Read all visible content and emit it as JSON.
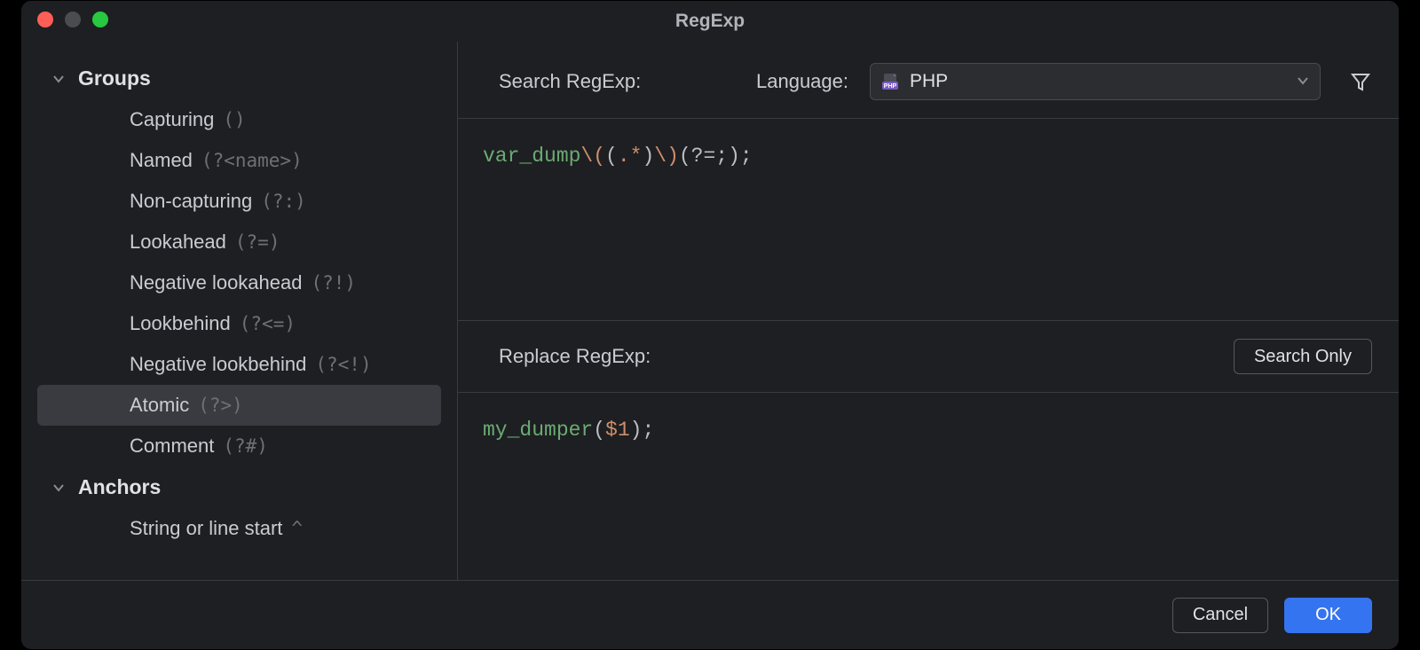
{
  "window": {
    "title": "RegExp"
  },
  "sidebar": {
    "sections": [
      {
        "title": "Groups",
        "expanded": true,
        "items": [
          {
            "label": "Capturing",
            "symbol": "()"
          },
          {
            "label": "Named",
            "symbol": "(?<name>)"
          },
          {
            "label": "Non-capturing",
            "symbol": "(?:)"
          },
          {
            "label": "Lookahead",
            "symbol": "(?=)"
          },
          {
            "label": "Negative lookahead",
            "symbol": "(?!)"
          },
          {
            "label": "Lookbehind",
            "symbol": "(?<=)"
          },
          {
            "label": "Negative lookbehind",
            "symbol": "(?<!)"
          },
          {
            "label": "Atomic",
            "symbol": "(?>)",
            "selected": true
          },
          {
            "label": "Comment",
            "symbol": "(?#)"
          }
        ]
      },
      {
        "title": "Anchors",
        "expanded": true,
        "items": [
          {
            "label": "String or line start",
            "symbol": "^"
          }
        ]
      }
    ]
  },
  "main": {
    "search_label": "Search RegExp:",
    "language_label": "Language:",
    "language_value": "PHP",
    "replace_label": "Replace RegExp:",
    "search_only_label": "Search Only",
    "search_code": {
      "fn": "var_dump",
      "esc_open": "\\(",
      "group_open": "(",
      "any": ".*",
      "group_close": ")",
      "esc_close": "\\)",
      "look_open": "(?=",
      "look_body": ";",
      "look_close": ")",
      "tail": ";"
    },
    "replace_code": {
      "fn": "my_dumper",
      "open": "(",
      "var": "$1",
      "close": ")",
      "tail": ";"
    }
  },
  "footer": {
    "cancel_label": "Cancel",
    "ok_label": "OK"
  }
}
